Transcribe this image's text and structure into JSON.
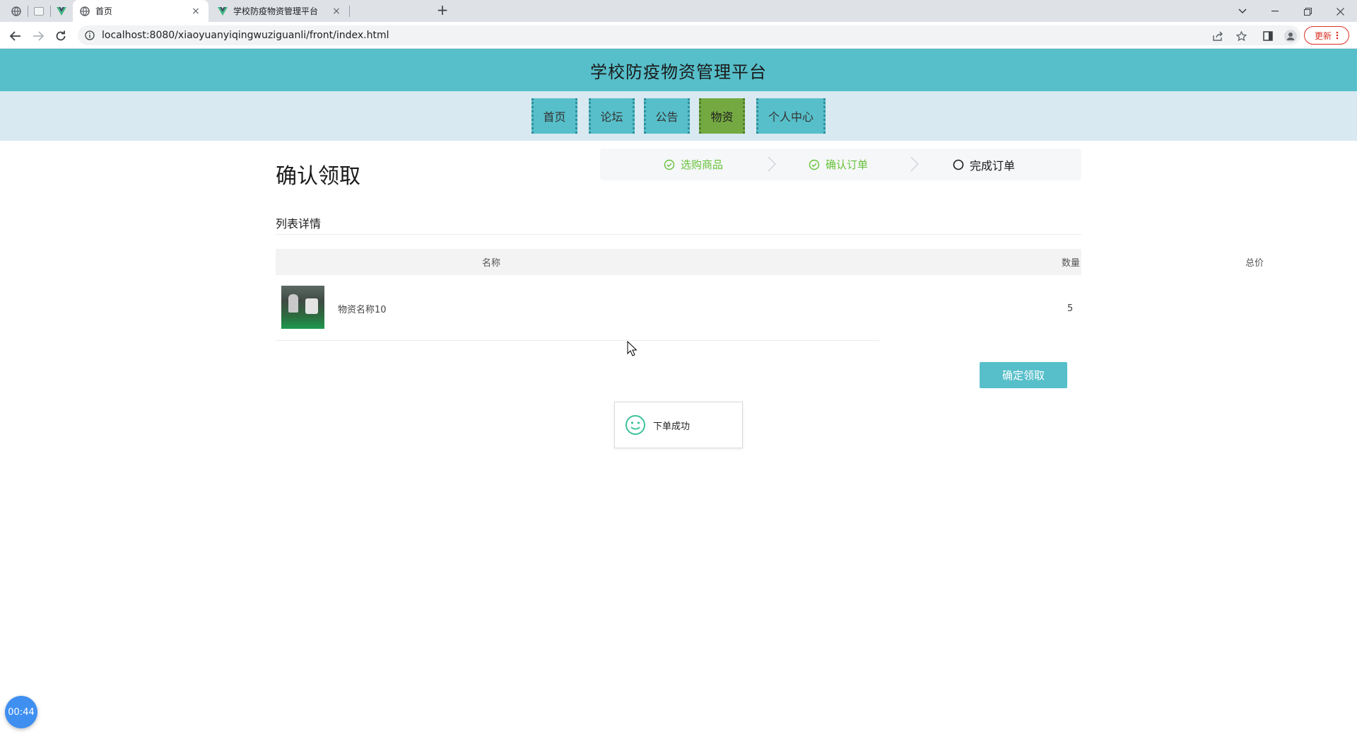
{
  "browser": {
    "tabs": [
      {
        "title": "首页",
        "active": true
      },
      {
        "title": "学校防疫物资管理平台",
        "active": false
      }
    ],
    "new_tab_symbol": "+",
    "close_symbol": "×",
    "url": "localhost:8080/xiaoyuanyiqingwuziguanli/front/index.html",
    "update_label": "更新"
  },
  "site": {
    "title": "学校防疫物资管理平台",
    "nav": [
      {
        "label": "首页",
        "active": false
      },
      {
        "label": "论坛",
        "active": false
      },
      {
        "label": "公告",
        "active": false
      },
      {
        "label": "物资",
        "active": true
      },
      {
        "label": "个人中心",
        "active": false
      }
    ]
  },
  "page": {
    "title": "确认领取",
    "steps": [
      {
        "label": "选购商品",
        "status": "done"
      },
      {
        "label": "确认订单",
        "status": "done"
      },
      {
        "label": "完成订单",
        "status": "current"
      }
    ],
    "section_label": "列表详情",
    "table": {
      "headers": [
        "名称",
        "数量",
        "总价"
      ],
      "rows": [
        {
          "name": "物资名称10",
          "quantity": "5",
          "total": ""
        }
      ]
    },
    "confirm_button": "确定领取",
    "toast_message": "下单成功"
  },
  "timer": "00:44",
  "colors": {
    "accent": "#57bfca",
    "nav_active": "#74a942",
    "step_done": "#67c23a",
    "nav_strip": "#d8e9f1"
  }
}
